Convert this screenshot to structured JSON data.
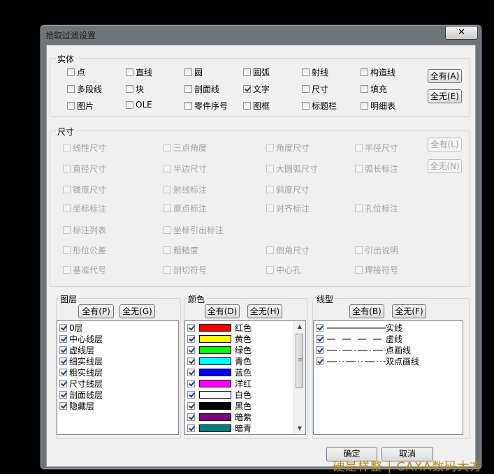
{
  "window": {
    "title": "拾取过滤设置",
    "close_label": "✕"
  },
  "entity": {
    "title": "实体",
    "items": [
      {
        "label": "点",
        "checked": false
      },
      {
        "label": "直线",
        "checked": false
      },
      {
        "label": "圆",
        "checked": false
      },
      {
        "label": "圆弧",
        "checked": false
      },
      {
        "label": "射线",
        "checked": false
      },
      {
        "label": "构造线",
        "checked": false
      },
      {
        "label": "多段线",
        "checked": false
      },
      {
        "label": "块",
        "checked": false
      },
      {
        "label": "剖面线",
        "checked": false
      },
      {
        "label": "文字",
        "checked": true
      },
      {
        "label": "尺寸",
        "checked": false
      },
      {
        "label": "填充",
        "checked": false
      },
      {
        "label": "图片",
        "checked": false
      },
      {
        "label": "OLE",
        "checked": false
      },
      {
        "label": "零件序号",
        "checked": false
      },
      {
        "label": "图框",
        "checked": false
      },
      {
        "label": "标题栏",
        "checked": false
      },
      {
        "label": "明细表",
        "checked": false
      }
    ],
    "all_label": "全有(A)",
    "none_label": "全无(E)"
  },
  "dimension": {
    "title": "尺寸",
    "items": [
      {
        "label": "线性尺寸"
      },
      {
        "label": "三点角度"
      },
      {
        "label": "角度尺寸"
      },
      {
        "label": "半径尺寸"
      },
      {
        "label": "直径尺寸"
      },
      {
        "label": "半边尺寸"
      },
      {
        "label": "大圆弧尺寸"
      },
      {
        "label": "弧长标注"
      },
      {
        "label": "锥度尺寸"
      },
      {
        "label": "射线标注"
      },
      {
        "label": "斜度尺寸"
      },
      {
        "label": "坐标标注"
      },
      {
        "label": "原点标注"
      },
      {
        "label": "对齐标注"
      },
      {
        "label": "孔位标注"
      },
      {
        "label": "标注列表"
      },
      {
        "label": "坐标引出标注"
      },
      {
        "label": "形位公差"
      },
      {
        "label": "粗糙度"
      },
      {
        "label": "倒角尺寸"
      },
      {
        "label": "引出说明"
      },
      {
        "label": "基准代号"
      },
      {
        "label": "剖切符号"
      },
      {
        "label": "中心孔"
      },
      {
        "label": "焊接符号"
      }
    ],
    "all_label": "全有(L)",
    "none_label": "全无(N)"
  },
  "layer": {
    "title": "图层",
    "all_label": "全有(P)",
    "none_label": "全无(G)",
    "items": [
      {
        "label": "0层",
        "checked": true
      },
      {
        "label": "中心线层",
        "checked": true
      },
      {
        "label": "虚线层",
        "checked": true
      },
      {
        "label": "细实线层",
        "checked": true
      },
      {
        "label": "粗实线层",
        "checked": true
      },
      {
        "label": "尺寸线层",
        "checked": true
      },
      {
        "label": "剖面线层",
        "checked": true
      },
      {
        "label": "隐藏层",
        "checked": true
      }
    ]
  },
  "color": {
    "title": "颜色",
    "all_label": "全有(D)",
    "none_label": "全无(H)",
    "items": [
      {
        "label": "红色",
        "hex": "#ff0000",
        "checked": true
      },
      {
        "label": "黄色",
        "hex": "#ffff00",
        "checked": true
      },
      {
        "label": "绿色",
        "hex": "#00ff00",
        "checked": true
      },
      {
        "label": "青色",
        "hex": "#00ffff",
        "checked": true
      },
      {
        "label": "蓝色",
        "hex": "#0000ff",
        "checked": true
      },
      {
        "label": "洋红",
        "hex": "#ff00ff",
        "checked": true
      },
      {
        "label": "白色",
        "hex": "#ffffff",
        "checked": true
      },
      {
        "label": "黑色",
        "hex": "#000000",
        "checked": true
      },
      {
        "label": "暗紫",
        "hex": "#800080",
        "checked": true
      },
      {
        "label": "暗青",
        "hex": "#008080",
        "checked": true
      }
    ]
  },
  "linetype": {
    "title": "线型",
    "all_label": "全有(B)",
    "none_label": "全无(F)",
    "items": [
      {
        "label": "实线",
        "dash": "none",
        "checked": true
      },
      {
        "label": "虚线",
        "dash": "12,10",
        "checked": true
      },
      {
        "label": "点画线",
        "dash": "14,3,2,3",
        "checked": true
      },
      {
        "label": "双点画线",
        "dash": "14,3,2,3,2,3",
        "checked": true
      }
    ]
  },
  "footer": {
    "ok_label": "确定",
    "cancel_label": "取消"
  },
  "watermark": "硬是样整 | CAXA数码大方"
}
